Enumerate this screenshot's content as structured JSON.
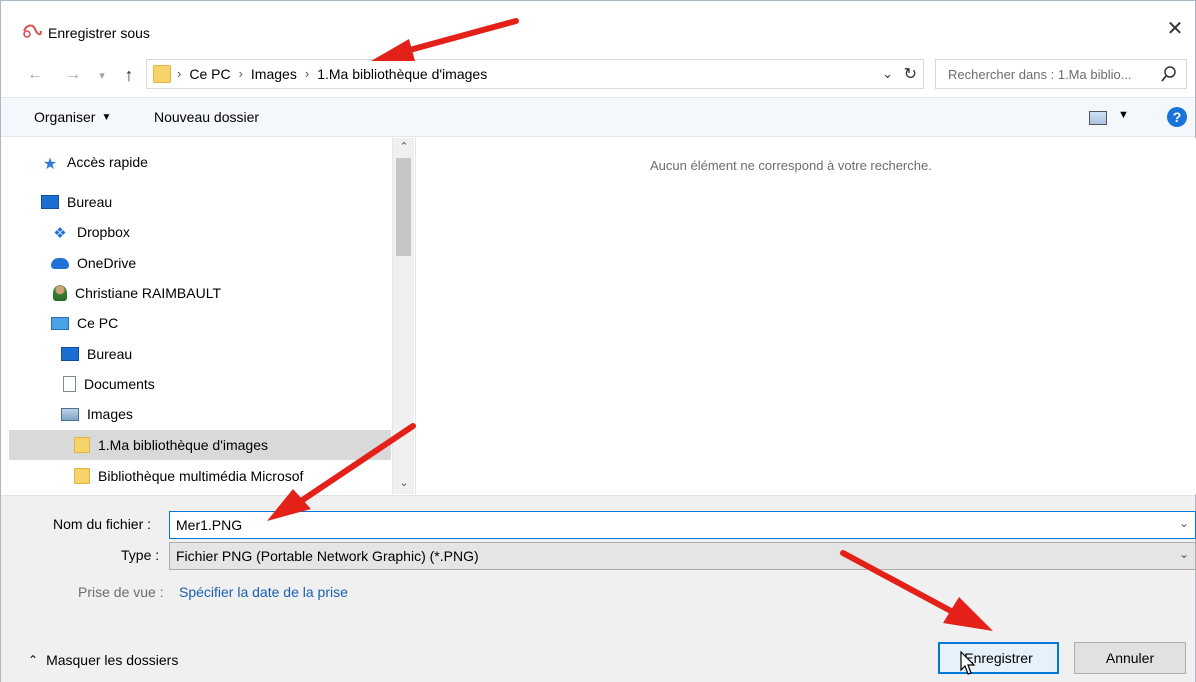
{
  "window": {
    "title": "Enregistrer sous",
    "close_glyph": "✕"
  },
  "address": {
    "crumbs": [
      "Ce PC",
      "Images",
      "1.Ma bibliothèque d'images"
    ],
    "separator": "›",
    "search_placeholder": "Rechercher dans : 1.Ma biblio..."
  },
  "toolbar": {
    "organiser_label": "Organiser",
    "nouveau_dossier_label": "Nouveau dossier",
    "help_glyph": "?"
  },
  "nav": {
    "items": [
      {
        "label": "Accès rapide",
        "icon": "star-icon"
      },
      {
        "label": "Bureau",
        "icon": "desktop-icon"
      },
      {
        "label": "Dropbox",
        "icon": "dropbox-icon"
      },
      {
        "label": "OneDrive",
        "icon": "onedrive-icon"
      },
      {
        "label": "Christiane RAIMBAULT",
        "icon": "user-icon"
      },
      {
        "label": "Ce PC",
        "icon": "computer-icon"
      },
      {
        "label": "Bureau",
        "icon": "desktop-icon"
      },
      {
        "label": "Documents",
        "icon": "document-icon"
      },
      {
        "label": "Images",
        "icon": "pictures-icon"
      },
      {
        "label": "1.Ma bibliothèque d'images",
        "icon": "folder-icon",
        "selected": true
      },
      {
        "label": "Bibliothèque multimédia Microsof",
        "icon": "folder-icon"
      }
    ]
  },
  "content": {
    "empty_message": "Aucun élément ne correspond à votre recherche."
  },
  "form": {
    "filename_label": "Nom du fichier :",
    "filename_value": "Mer1.PNG",
    "type_label": "Type :",
    "type_value": "Fichier PNG (Portable Network Graphic) (*.PNG)",
    "prise_label": "Prise de vue :",
    "prise_link": "Spécifier la date de la prise"
  },
  "footer": {
    "hide_folders_label": "Masquer les dossiers",
    "save_label": "Enregistrer",
    "cancel_label": "Annuler"
  },
  "colors": {
    "accent": "#0078d7",
    "annotation_arrow": "#e32119"
  }
}
